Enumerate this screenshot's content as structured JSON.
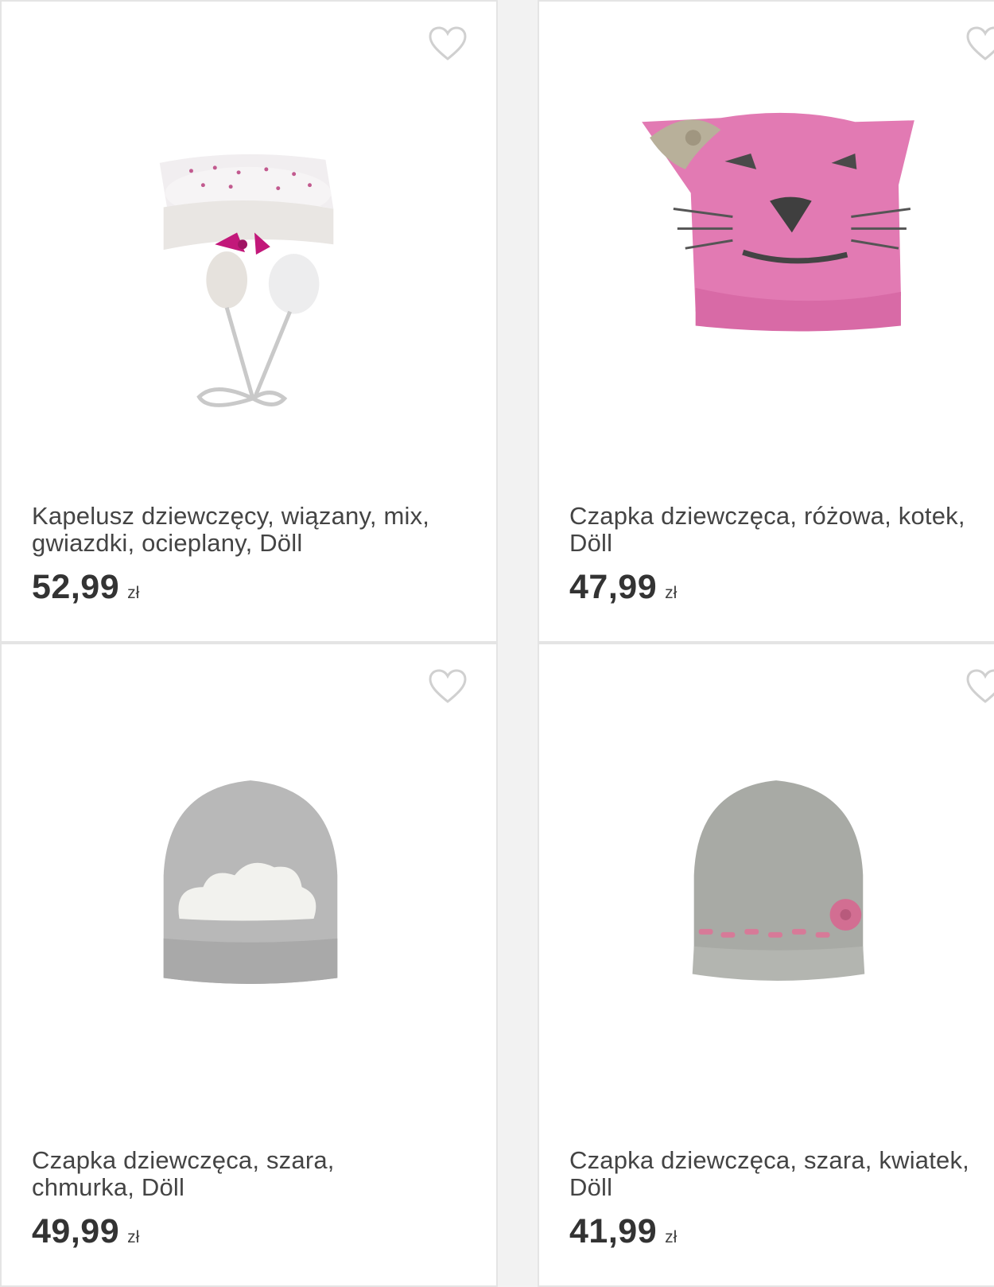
{
  "products": [
    {
      "title_line1": "Kapelusz dziewczęcy, wiązany, mix,",
      "title_line2": "gwiazdki, ocieplany, Döll",
      "price": "52,99",
      "currency": "zł"
    },
    {
      "title_line1": "Czapka dziewczęca, różowa, kotek,",
      "title_line2": "Döll",
      "price": "47,99",
      "currency": "zł"
    },
    {
      "title_line1": "Czapka dziewczęca, szara,",
      "title_line2": "chmurka, Döll",
      "price": "49,99",
      "currency": "zł"
    },
    {
      "title_line1": "Czapka dziewczęca, szara, kwiatek,",
      "title_line2": "Döll",
      "price": "41,99",
      "currency": "zł"
    }
  ],
  "colors": {
    "accent_pink": "#e04ea0",
    "heart_outline": "#d0d0d0"
  }
}
